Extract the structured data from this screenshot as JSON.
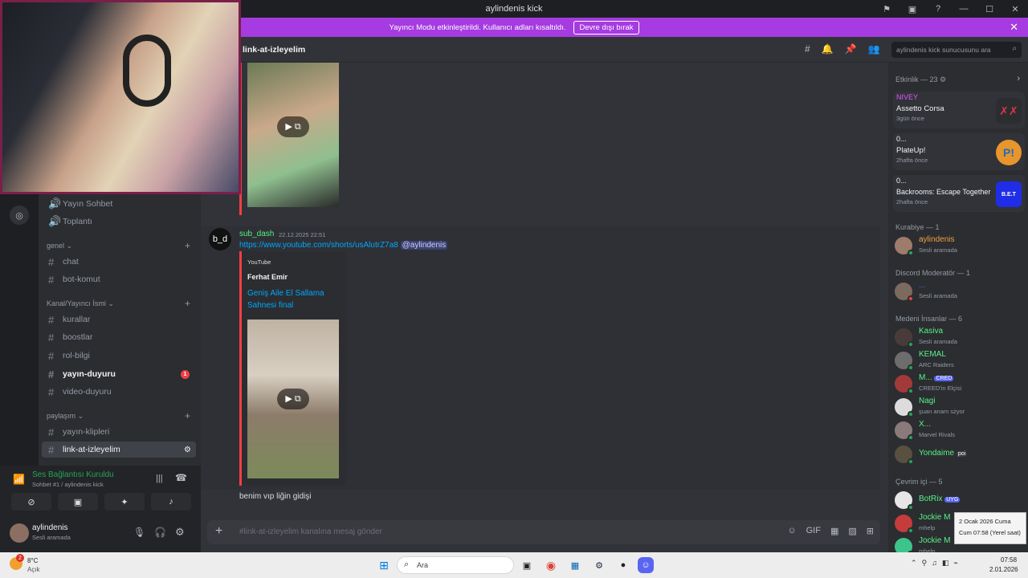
{
  "window": {
    "title": "aylindenis kick"
  },
  "banner": {
    "text": "Yayıncı Modu etkinleştirildi. Kullanıcı adları kısaltıldı.",
    "button": "Devre dışı bırak"
  },
  "header": {
    "channel": "link-at-izleyelim",
    "search_placeholder": "aylindenis kick sunucusunu ara"
  },
  "sidebar": {
    "voice_channels": [
      "Yayın Sohbet",
      "Toplantı"
    ],
    "categories": [
      {
        "name": "genel",
        "channels": [
          "chat",
          "bot-komut"
        ]
      },
      {
        "name": "Kanal/Yayıncı İsmi",
        "channels": [
          "kurallar",
          "boostlar",
          "rol-bilgi",
          "yayın-duyuru",
          "video-duyuru"
        ]
      },
      {
        "name": "paylaşım",
        "channels": [
          "yayın-klipleri",
          "link-at-izleyelim"
        ]
      }
    ],
    "unread_badge": "1"
  },
  "voice": {
    "status": "Ses Bağlantısı Kuruldu",
    "channel": "Sohbet #1 / aylindenis kick"
  },
  "user": {
    "name": "aylindenis",
    "status": "Sesli aramada"
  },
  "messages": [
    {
      "author": "sub_dash",
      "avatar_text": "b_d",
      "timestamp": "22.12.2025 22:51",
      "link": "https://www.youtube.com/shorts/usAlutrZ7a8",
      "mention": "@aylindenis",
      "embed": {
        "provider": "YouTube",
        "author": "Ferhat Emir",
        "title": "Geniş Aile El Sallama Sahnesi final"
      }
    }
  ],
  "last_message": "benim vıp liğin gidişi",
  "composer": {
    "placeholder": "#link-at-izleyelim kanalına mesaj gönder"
  },
  "members": {
    "activity_header": "Etkinlik — 23",
    "activities": [
      {
        "name": "NIVEY",
        "game": "Assetto Corsa",
        "time": "3gün önce",
        "name_color": "#e056fd"
      },
      {
        "name": "0...",
        "game": "PlateUp!",
        "time": "2hafta önce",
        "name_color": "#f2f3f5"
      },
      {
        "name": "0...",
        "game": "Backrooms: Escape Together",
        "time": "2hafta önce",
        "name_color": "#f2f3f5"
      }
    ],
    "sections": [
      {
        "title": "Kurabiye — 1",
        "members": [
          {
            "name": "aylindenis",
            "status": "Sesli aramada",
            "color": "#f0a040"
          }
        ]
      },
      {
        "title": "Discord Moderatör — 1",
        "members": [
          {
            "name": "...",
            "status": "Sesli aramada",
            "color": "#5865f2"
          }
        ]
      },
      {
        "title": "Medeni İnsanlar — 6",
        "members": [
          {
            "name": "Kasiva",
            "status": "Sesli aramada",
            "color": "#57f287"
          },
          {
            "name": "KEMAL",
            "status": "ARC Raiders",
            "color": "#57f287"
          },
          {
            "name": "M...",
            "tag": "CRED",
            "status": "CREED'in Elçisi",
            "color": "#57f287"
          },
          {
            "name": "Nagi",
            "status": "şuan anam sżyor",
            "color": "#57f287"
          },
          {
            "name": "X...",
            "status": "Marvel Rivals",
            "color": "#57f287"
          },
          {
            "name": "Yondaime",
            "tag": "poi",
            "status": "",
            "color": "#57f287"
          }
        ]
      },
      {
        "title": "Çevrim içi — 5",
        "members": [
          {
            "name": "BotRix",
            "tag": "UYG",
            "status": "",
            "color": "#57f287"
          },
          {
            "name": "Jockie M",
            "status": "mhelp",
            "color": "#57f287"
          },
          {
            "name": "Jockie M",
            "status": "mhelp",
            "color": "#57f287"
          }
        ]
      }
    ]
  },
  "taskbar": {
    "weather_temp": "8°C",
    "weather_desc": "Açık",
    "search": "Ara",
    "time": "07:58",
    "date": "2.01.2026",
    "notif_badge": "2"
  },
  "tooltip": {
    "line1": "2 Ocak 2026 Cuma",
    "line2": "Cum 07:58 (Yerel saat)"
  }
}
